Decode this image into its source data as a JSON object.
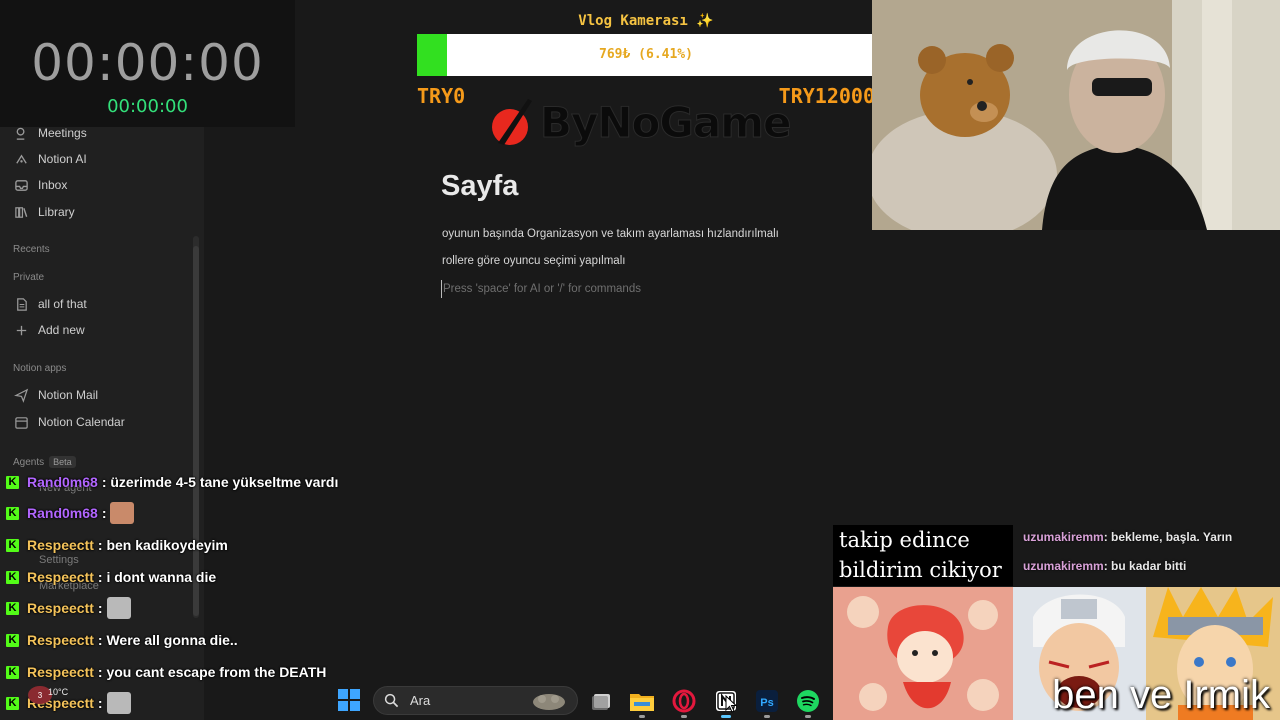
{
  "timer": {
    "main": "00:00:00",
    "sub": "00:00:00"
  },
  "goal": {
    "title": "Vlog Kamerası ✨",
    "progress_text": "769₺ (6.41%)",
    "progress_fraction": 0.0641,
    "min_label": "TRY0",
    "max_label": "TRY12000",
    "brand": "ByNoGame"
  },
  "sidebar": {
    "items_top": [
      {
        "label": "Meetings",
        "icon": "meetings-icon"
      },
      {
        "label": "Notion AI",
        "icon": "notion-ai-icon"
      },
      {
        "label": "Inbox",
        "icon": "inbox-icon"
      },
      {
        "label": "Library",
        "icon": "library-icon"
      }
    ],
    "recents_label": "Recents",
    "private_label": "Private",
    "private_items": [
      {
        "label": "all of that",
        "icon": "page-icon"
      },
      {
        "label": "Add new",
        "icon": "plus-icon"
      }
    ],
    "apps_label": "Notion apps",
    "apps": [
      {
        "label": "Notion Mail",
        "icon": "mail-send-icon"
      },
      {
        "label": "Notion Calendar",
        "icon": "calendar-icon"
      }
    ],
    "agents_label": "Agents",
    "beta_label": "Beta",
    "new_agent": "New agent",
    "settings": "Settings",
    "marketplace": "Marketplace"
  },
  "page": {
    "title": "Sayfa",
    "paragraphs": [
      "oyunun başında Organizasyon ve takım ayarlaması hızlandırılmalı",
      "rollere göre oyuncu seçimi yapılmalı"
    ],
    "editor_placeholder": "Press 'space' for AI or '/' for commands"
  },
  "chat": [
    {
      "user": "Rand0m68",
      "color": "#b266ff",
      "msg": ": üzerimde 4-5 tane yükseltme vardı",
      "emote": ""
    },
    {
      "user": "Rand0m68",
      "color": "#b266ff",
      "msg": ":",
      "emote": "face-emote"
    },
    {
      "user": "Respeectt",
      "color": "#f4c35a",
      "msg": ": ben kadikoydeyim",
      "emote": ""
    },
    {
      "user": "Respeectt",
      "color": "#f4c35a",
      "msg": ": i dont wanna die",
      "emote": ""
    },
    {
      "user": "Respeectt",
      "color": "#f4c35a",
      "msg": ":",
      "emote": "cat-emote"
    },
    {
      "user": "Respeectt",
      "color": "#f4c35a",
      "msg": ": Were all gonna die..",
      "emote": ""
    },
    {
      "user": "Respeectt",
      "color": "#f4c35a",
      "msg": ": you cant escape from the DEATH",
      "emote": ""
    },
    {
      "user": "Respeectt",
      "color": "#f4c35a",
      "msg": ":",
      "emote": "cat-emote"
    }
  ],
  "kick_badge": "K",
  "taskbar": {
    "weather_badge": "3",
    "temperature": "10°C",
    "search_placeholder": "Ara",
    "apps": [
      "task-view-icon",
      "file-explorer-icon",
      "opera-gx-icon",
      "notion-icon",
      "photoshop-icon",
      "spotify-icon"
    ],
    "photoshop_label": "Ps"
  },
  "follow_alert": {
    "line1": "takip edince",
    "line2": "bildirim cikiyor"
  },
  "side_chat": [
    {
      "user": "uzumakiremm",
      "msg": ": bekleme, başla. Yarın"
    },
    {
      "user": "uzumakiremm",
      "msg": ": bu kadar bitti"
    }
  ],
  "pics_caption": "ben ve Irmik"
}
